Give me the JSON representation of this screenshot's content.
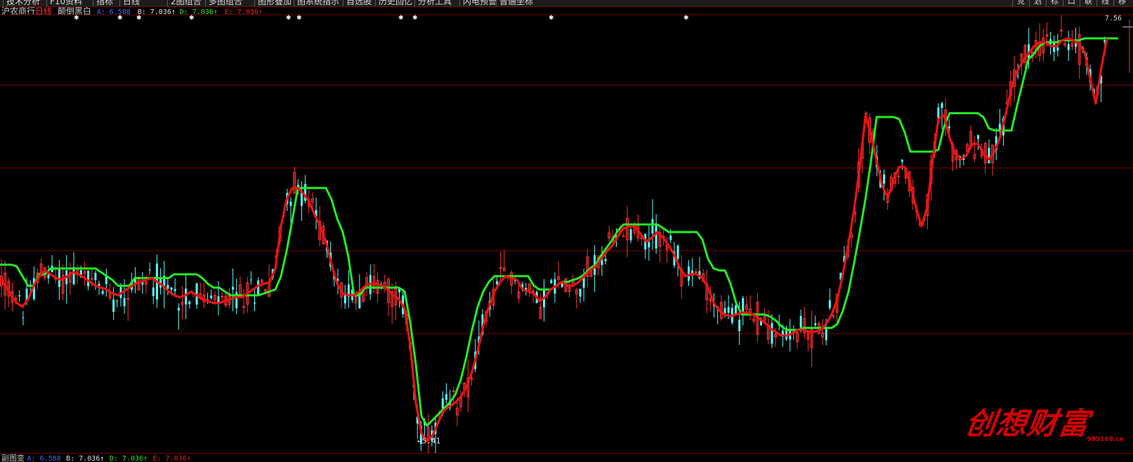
{
  "menu": {
    "items": [
      "技术分析",
      "F10资料",
      "指标",
      "日线",
      "2图组合",
      "多图组合",
      "图形叠加",
      "图",
      "系统指示",
      "自选股",
      "历史回忆",
      "分析工具",
      "闪电预警",
      "普通坐标"
    ],
    "right_buttons": [
      "竞",
      "划",
      "标",
      "口",
      "联",
      "线",
      "移"
    ]
  },
  "header": {
    "stock_name": "沪农商行",
    "period": "日线",
    "indicator": "颠倒黑白",
    "a_label": "A: 6.588",
    "b_label": "B: 7.036↑",
    "d_label": "D: 7.036↑",
    "e_label": "E: 7.036↑"
  },
  "bottom": {
    "name": "副图变",
    "a_label": "A: 6.588",
    "b_label": "B: 7.036↑",
    "d_label": "D: 7.036↑",
    "e_label": "E: 7.036↑"
  },
  "price_label": "7.56",
  "low_label": "←5.41",
  "watermark": {
    "text": "创想财富",
    "url": "995168.cn"
  },
  "colors": {
    "background": "#000000",
    "grid": "#7a0000",
    "up_candle": "#ff3030",
    "down_candle": "#54ffff",
    "green_line": "#22ee22",
    "red_line": "#ee1111",
    "a_color": "#3a6cff",
    "b_color": "#e0e0e0",
    "d_color": "#22ee22",
    "e_color": "#ee2222"
  },
  "chart_data": {
    "type": "line",
    "title": "沪农商行 日线",
    "x": [
      0,
      8,
      16,
      24,
      32,
      40,
      48,
      56,
      64,
      72,
      80,
      88,
      96,
      104,
      112,
      120,
      128,
      136,
      144,
      152,
      160,
      168,
      176,
      184,
      192,
      200,
      208,
      216,
      224,
      232,
      240,
      248,
      256,
      264,
      272,
      280,
      288,
      296,
      304,
      312,
      320,
      328,
      336,
      344,
      352,
      360,
      368,
      376,
      384,
      392,
      400,
      408,
      416,
      424,
      432,
      440,
      448,
      456,
      464,
      472,
      480,
      488,
      496,
      504,
      512,
      520,
      528,
      536,
      544,
      552,
      560,
      568,
      576,
      584,
      592,
      600,
      608,
      616,
      624,
      632,
      640,
      648,
      656,
      664,
      672,
      680,
      688,
      696,
      704,
      712,
      720,
      728,
      736,
      744,
      752,
      760,
      768,
      776,
      784,
      792,
      800,
      808,
      816,
      824,
      832,
      840,
      848,
      856,
      864,
      872,
      880,
      888,
      896,
      904,
      912,
      920,
      928,
      936,
      944,
      952,
      960,
      968,
      976,
      984,
      992,
      1000,
      1008,
      1016,
      1024,
      1032,
      1040,
      1048,
      1056,
      1064,
      1072,
      1080,
      1088,
      1096,
      1104,
      1112,
      1120,
      1128,
      1136,
      1144,
      1152,
      1160,
      1168,
      1176,
      1184,
      1192,
      1200,
      1208,
      1216,
      1224,
      1232,
      1240,
      1248,
      1256,
      1264,
      1272,
      1280,
      1288,
      1296,
      1304,
      1312,
      1320,
      1328,
      1336,
      1344,
      1352,
      1360,
      1368,
      1376,
      1384,
      1392,
      1400,
      1408,
      1416,
      1424,
      1432,
      1440,
      1448,
      1456,
      1464,
      1472,
      1480,
      1488,
      1496,
      1504,
      1512,
      1520,
      1528,
      1536,
      1544,
      1552,
      1560,
      1568,
      1576,
      1584,
      1592,
      1600,
      1608
    ],
    "series": [
      {
        "color": "#ee1111",
        "values": [
          6.25,
          6.21,
          6.16,
          6.12,
          6.1,
          6.14,
          6.21,
          6.26,
          6.29,
          6.27,
          6.25,
          6.24,
          6.26,
          6.28,
          6.27,
          6.25,
          6.23,
          6.21,
          6.2,
          6.19,
          6.17,
          6.16,
          6.18,
          6.2,
          6.22,
          6.23,
          6.24,
          6.25,
          6.23,
          6.21,
          6.18,
          6.16,
          6.15,
          6.16,
          6.18,
          6.16,
          6.14,
          6.13,
          6.12,
          6.12,
          6.13,
          6.14,
          6.15,
          6.15,
          6.17,
          6.19,
          6.21,
          6.22,
          6.23,
          6.3,
          6.52,
          6.66,
          6.72,
          6.72,
          6.69,
          6.65,
          6.58,
          6.52,
          6.44,
          6.32,
          6.22,
          6.17,
          6.16,
          6.16,
          6.18,
          6.21,
          6.22,
          6.22,
          6.21,
          6.19,
          6.16,
          6.14,
          6.09,
          5.9,
          5.6,
          5.44,
          5.4,
          5.43,
          5.5,
          5.56,
          5.58,
          5.6,
          5.63,
          5.68,
          5.76,
          5.87,
          6.0,
          6.1,
          6.18,
          6.23,
          6.26,
          6.25,
          6.24,
          6.19,
          6.18,
          6.17,
          6.13,
          6.15,
          6.19,
          6.21,
          6.23,
          6.21,
          6.21,
          6.23,
          6.26,
          6.29,
          6.31,
          6.35,
          6.39,
          6.42,
          6.47,
          6.51,
          6.52,
          6.52,
          6.48,
          6.44,
          6.46,
          6.49,
          6.46,
          6.42,
          6.37,
          6.3,
          6.26,
          6.27,
          6.27,
          6.25,
          6.2,
          6.12,
          6.08,
          6.06,
          6.05,
          6.06,
          6.07,
          6.07,
          6.06,
          6.04,
          6.02,
          5.99,
          5.97,
          5.95,
          5.95,
          5.96,
          5.98,
          5.98,
          5.97,
          5.97,
          5.98,
          6.01,
          6.06,
          6.14,
          6.27,
          6.43,
          6.61,
          6.83,
          7.09,
          7.0,
          6.86,
          6.73,
          6.67,
          6.76,
          6.83,
          6.83,
          6.74,
          6.62,
          6.52,
          6.62,
          6.87,
          7.08,
          7.1,
          6.98,
          6.9,
          6.87,
          6.89,
          6.95,
          6.95,
          6.9,
          6.87,
          6.91,
          6.99,
          7.11,
          7.24,
          7.33,
          7.38,
          7.42,
          7.46,
          7.48,
          7.48,
          7.46,
          7.46,
          7.49,
          7.5,
          7.49,
          7.47,
          7.43,
          7.29,
          7.16,
          7.35,
          7.5
        ]
      },
      {
        "color": "#22ee22",
        "values": [
          6.32,
          6.32,
          6.32,
          6.31,
          6.26,
          6.21,
          6.21,
          6.27,
          6.27,
          6.3,
          6.3,
          6.3,
          6.3,
          6.3,
          6.3,
          6.3,
          6.3,
          6.3,
          6.28,
          6.26,
          6.24,
          6.21,
          6.21,
          6.21,
          6.25,
          6.25,
          6.25,
          6.25,
          6.25,
          6.25,
          6.25,
          6.27,
          6.27,
          6.27,
          6.27,
          6.27,
          6.25,
          6.22,
          6.2,
          6.2,
          6.18,
          6.16,
          6.16,
          6.16,
          6.16,
          6.16,
          6.16,
          6.17,
          6.18,
          6.19,
          6.26,
          6.39,
          6.55,
          6.72,
          6.72,
          6.72,
          6.72,
          6.72,
          6.72,
          6.66,
          6.56,
          6.49,
          6.36,
          6.16,
          6.16,
          6.2,
          6.2,
          6.2,
          6.2,
          6.2,
          6.2,
          6.2,
          6.18,
          6.02,
          5.8,
          5.53,
          5.48,
          5.51,
          5.54,
          5.57,
          5.6,
          5.64,
          5.72,
          5.84,
          5.98,
          6.1,
          6.18,
          6.23,
          6.26,
          6.26,
          6.26,
          6.26,
          6.26,
          6.26,
          6.26,
          6.21,
          6.19,
          6.19,
          6.19,
          6.21,
          6.23,
          6.23,
          6.24,
          6.25,
          6.27,
          6.3,
          6.32,
          6.37,
          6.41,
          6.45,
          6.5,
          6.53,
          6.53,
          6.53,
          6.53,
          6.53,
          6.53,
          6.53,
          6.51,
          6.49,
          6.49,
          6.49,
          6.49,
          6.49,
          6.49,
          6.45,
          6.35,
          6.3,
          6.29,
          6.29,
          6.22,
          6.12,
          6.06,
          6.06,
          6.06,
          6.06,
          6.06,
          6.05,
          6.03,
          6.0,
          5.98,
          5.98,
          5.98,
          5.99,
          5.99,
          5.99,
          5.99,
          5.99,
          5.99,
          6.01,
          6.08,
          6.18,
          6.33,
          6.49,
          6.66,
          6.86,
          7.09,
          7.09,
          7.09,
          7.09,
          7.08,
          7.01,
          6.91,
          6.91,
          6.91,
          6.91,
          6.91,
          6.92,
          7.04,
          7.11,
          7.11,
          7.11,
          7.11,
          7.11,
          7.11,
          7.09,
          7.03,
          7.02,
          7.02,
          7.02,
          7.02,
          7.15,
          7.27,
          7.39,
          7.42,
          7.46,
          7.48,
          7.48,
          7.48,
          7.49,
          7.49,
          7.49,
          7.49,
          7.5,
          7.5,
          7.5,
          7.5,
          7.5,
          7.5,
          7.5
        ]
      }
    ],
    "ylim": [
      5.36,
      7.62
    ],
    "grid_y": [
      7.256,
      6.824,
      6.392,
      5.96
    ],
    "annotations": [
      {
        "text": "7.56",
        "value": 7.56
      },
      {
        "text": "←5.41",
        "value": 5.41
      }
    ],
    "ylabel": "",
    "xlabel": ""
  }
}
